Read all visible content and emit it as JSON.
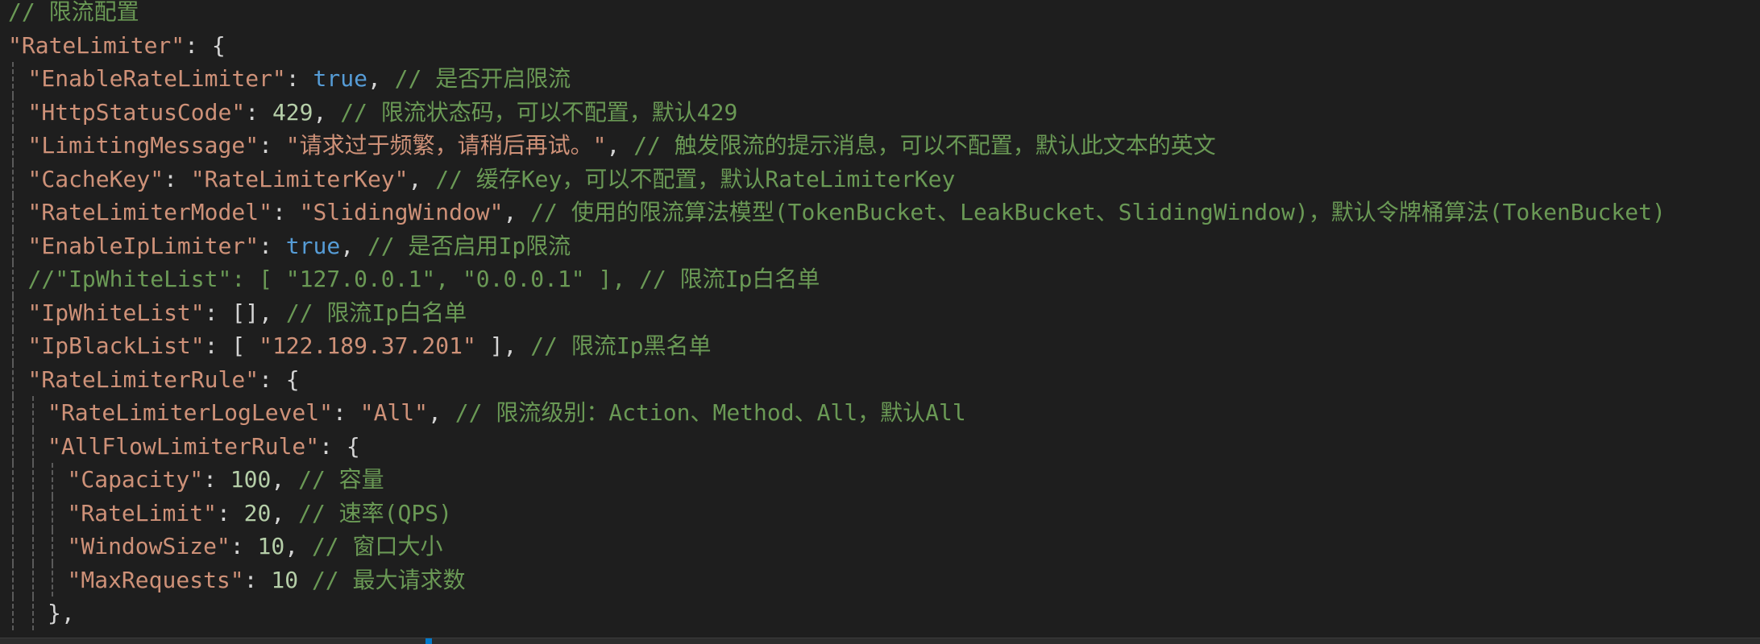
{
  "editor": {
    "lines": [
      {
        "indent": 0,
        "tokens": [
          {
            "t": "c",
            "v": "// 限流配置"
          }
        ]
      },
      {
        "indent": 0,
        "tokens": [
          {
            "t": "k",
            "v": "\"RateLimiter\""
          },
          {
            "t": "p",
            "v": ": {"
          }
        ]
      },
      {
        "indent": 1,
        "tokens": [
          {
            "t": "k",
            "v": "\"EnableRateLimiter\""
          },
          {
            "t": "p",
            "v": ": "
          },
          {
            "t": "b",
            "v": "true"
          },
          {
            "t": "p",
            "v": ", "
          },
          {
            "t": "c",
            "v": "// 是否开启限流"
          }
        ]
      },
      {
        "indent": 1,
        "tokens": [
          {
            "t": "k",
            "v": "\"HttpStatusCode\""
          },
          {
            "t": "p",
            "v": ": "
          },
          {
            "t": "n",
            "v": "429"
          },
          {
            "t": "p",
            "v": ", "
          },
          {
            "t": "c",
            "v": "// 限流状态码，可以不配置，默认429"
          }
        ]
      },
      {
        "indent": 1,
        "tokens": [
          {
            "t": "k",
            "v": "\"LimitingMessage\""
          },
          {
            "t": "p",
            "v": ": "
          },
          {
            "t": "s",
            "v": "\"请求过于频繁，请稍后再试。\""
          },
          {
            "t": "p",
            "v": ", "
          },
          {
            "t": "c",
            "v": "// 触发限流的提示消息，可以不配置，默认此文本的英文"
          }
        ]
      },
      {
        "indent": 1,
        "tokens": [
          {
            "t": "k",
            "v": "\"CacheKey\""
          },
          {
            "t": "p",
            "v": ": "
          },
          {
            "t": "s",
            "v": "\"RateLimiterKey\""
          },
          {
            "t": "p",
            "v": ", "
          },
          {
            "t": "c",
            "v": "// 缓存Key，可以不配置，默认RateLimiterKey"
          }
        ]
      },
      {
        "indent": 1,
        "tokens": [
          {
            "t": "k",
            "v": "\"RateLimiterModel\""
          },
          {
            "t": "p",
            "v": ": "
          },
          {
            "t": "s",
            "v": "\"SlidingWindow\""
          },
          {
            "t": "p",
            "v": ", "
          },
          {
            "t": "c",
            "v": "// 使用的限流算法模型(TokenBucket、LeakBucket、SlidingWindow)，默认令牌桶算法(TokenBucket)"
          }
        ]
      },
      {
        "indent": 1,
        "tokens": [
          {
            "t": "k",
            "v": "\"EnableIpLimiter\""
          },
          {
            "t": "p",
            "v": ": "
          },
          {
            "t": "b",
            "v": "true"
          },
          {
            "t": "p",
            "v": ", "
          },
          {
            "t": "c",
            "v": "// 是否启用Ip限流"
          }
        ]
      },
      {
        "indent": 1,
        "tokens": [
          {
            "t": "c",
            "v": "//\"IpWhiteList\": [ \"127.0.0.1\", \"0.0.0.1\" ], // 限流Ip白名单"
          }
        ]
      },
      {
        "indent": 1,
        "tokens": [
          {
            "t": "k",
            "v": "\"IpWhiteList\""
          },
          {
            "t": "p",
            "v": ": [], "
          },
          {
            "t": "c",
            "v": "// 限流Ip白名单"
          }
        ]
      },
      {
        "indent": 1,
        "tokens": [
          {
            "t": "k",
            "v": "\"IpBlackList\""
          },
          {
            "t": "p",
            "v": ": [ "
          },
          {
            "t": "s",
            "v": "\"122.189.37.201\""
          },
          {
            "t": "p",
            "v": " ], "
          },
          {
            "t": "c",
            "v": "// 限流Ip黑名单"
          }
        ]
      },
      {
        "indent": 1,
        "tokens": [
          {
            "t": "k",
            "v": "\"RateLimiterRule\""
          },
          {
            "t": "p",
            "v": ": {"
          }
        ]
      },
      {
        "indent": 2,
        "tokens": [
          {
            "t": "k",
            "v": "\"RateLimiterLogLevel\""
          },
          {
            "t": "p",
            "v": ": "
          },
          {
            "t": "s",
            "v": "\"All\""
          },
          {
            "t": "p",
            "v": ", "
          },
          {
            "t": "c",
            "v": "// 限流级别：Action、Method、All，默认All"
          }
        ]
      },
      {
        "indent": 2,
        "tokens": [
          {
            "t": "k",
            "v": "\"AllFlowLimiterRule\""
          },
          {
            "t": "p",
            "v": ": {"
          }
        ]
      },
      {
        "indent": 3,
        "tokens": [
          {
            "t": "k",
            "v": "\"Capacity\""
          },
          {
            "t": "p",
            "v": ": "
          },
          {
            "t": "n",
            "v": "100"
          },
          {
            "t": "p",
            "v": ", "
          },
          {
            "t": "c",
            "v": "// 容量"
          }
        ]
      },
      {
        "indent": 3,
        "tokens": [
          {
            "t": "k",
            "v": "\"RateLimit\""
          },
          {
            "t": "p",
            "v": ": "
          },
          {
            "t": "n",
            "v": "20"
          },
          {
            "t": "p",
            "v": ", "
          },
          {
            "t": "c",
            "v": "// 速率(QPS)"
          }
        ]
      },
      {
        "indent": 3,
        "tokens": [
          {
            "t": "k",
            "v": "\"WindowSize\""
          },
          {
            "t": "p",
            "v": ": "
          },
          {
            "t": "n",
            "v": "10"
          },
          {
            "t": "p",
            "v": ", "
          },
          {
            "t": "c",
            "v": "// 窗口大小"
          }
        ]
      },
      {
        "indent": 3,
        "tokens": [
          {
            "t": "k",
            "v": "\"MaxRequests\""
          },
          {
            "t": "p",
            "v": ": "
          },
          {
            "t": "n",
            "v": "10"
          },
          {
            "t": "p",
            "v": " "
          },
          {
            "t": "c",
            "v": "// 最大请求数"
          }
        ]
      },
      {
        "indent": 2,
        "tokens": [
          {
            "t": "p",
            "v": "},"
          }
        ]
      }
    ]
  },
  "colors": {
    "background": "#1e1e1e",
    "string": "#ce9178",
    "number": "#b5cea8",
    "boolean": "#569cd6",
    "comment": "#6a9955",
    "punctuation": "#d4d4d4"
  }
}
